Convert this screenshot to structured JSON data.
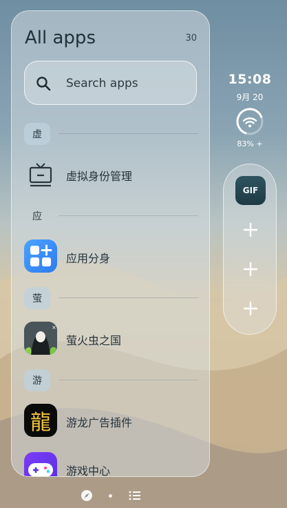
{
  "drawer": {
    "title": "All apps",
    "count": "30",
    "search_placeholder": "Search apps"
  },
  "sections": [
    {
      "letter": "虚",
      "apps": [
        {
          "name": "虚拟身份管理",
          "icon": "tv-icon"
        }
      ]
    },
    {
      "letter": "应",
      "apps": [
        {
          "name": "应用分身",
          "icon": "app-clone-icon"
        }
      ]
    },
    {
      "letter": "萤",
      "apps": [
        {
          "name": "萤火虫之国",
          "icon": "firefly-game-icon"
        }
      ]
    },
    {
      "letter": "游",
      "apps": [
        {
          "name": "游龙广告插件",
          "icon": "dragon-icon",
          "glyph": "龍"
        },
        {
          "name": "游戏中心",
          "icon": "gamepad-icon"
        }
      ]
    }
  ],
  "widgets": {
    "time": "15:08",
    "date": "9月 20",
    "battery": "83% +",
    "dock_gif_label": "GIF"
  },
  "colors": {
    "badge_bg": "#bed1dd",
    "clone_icon_blue": "#3a8ff5",
    "game_icon_purple": "#6a3cf0"
  }
}
